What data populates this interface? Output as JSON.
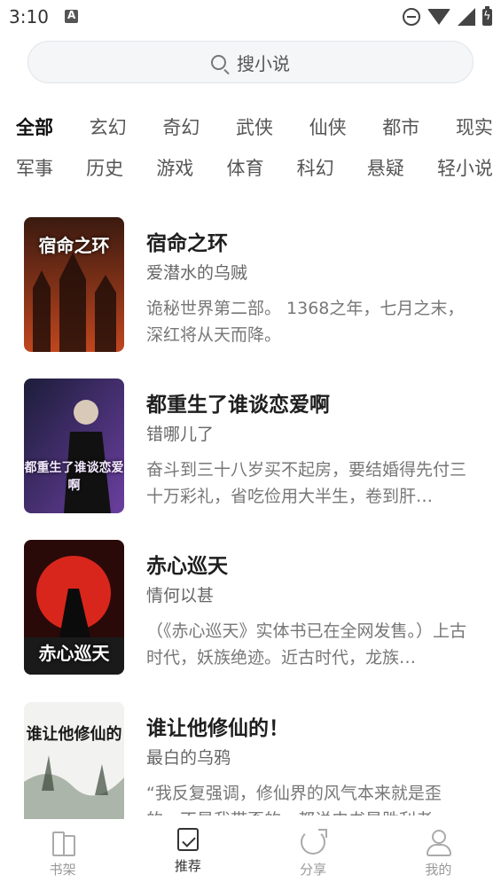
{
  "status_bar": {
    "time": "3:10"
  },
  "search": {
    "placeholder": "搜小说"
  },
  "categories": {
    "row1": [
      "全部",
      "玄幻",
      "奇幻",
      "武侠",
      "仙侠",
      "都市",
      "现实"
    ],
    "row2": [
      "军事",
      "历史",
      "游戏",
      "体育",
      "科幻",
      "悬疑",
      "轻小说"
    ],
    "active": "全部"
  },
  "books": [
    {
      "title": "宿命之环",
      "author": "爱潜水的乌贼",
      "desc": "诡秘世界第二部。 1368之年，七月之末，深红将从天而降。",
      "cover_text": "宿命之环",
      "cover_colors": [
        "#3a1a10",
        "#c0461f"
      ]
    },
    {
      "title": "都重生了谁谈恋爱啊",
      "author": "错哪儿了",
      "desc": "奋斗到三十八岁买不起房，要结婚得先付三十万彩礼，省吃俭用大半生，卷到肝…",
      "cover_text": "都重生了谁谈恋爱啊",
      "cover_colors": [
        "#1c1d3a",
        "#6b3fa0"
      ]
    },
    {
      "title": "赤心巡天",
      "author": "情何以甚",
      "desc": "（《赤心巡天》实体书已在全网发售。）上古时代，妖族绝迹。近古时代，龙族…",
      "cover_text": "赤心巡天",
      "cover_colors": [
        "#2a0a08",
        "#d9261c"
      ]
    },
    {
      "title": "谁让他修仙的！",
      "author": "最白的乌鸦",
      "desc": "“我反复强调，修仙界的风气本来就是歪的，不是我带歪的。都说史书是胜利者…",
      "cover_text": "谁让他修仙的",
      "cover_colors": [
        "#f2f2f0",
        "#7d8c7a"
      ]
    }
  ],
  "bottom_nav": [
    {
      "label": "书架",
      "icon": "bookshelf-icon"
    },
    {
      "label": "推荐",
      "icon": "bookmark-icon"
    },
    {
      "label": "分享",
      "icon": "share-icon"
    },
    {
      "label": "我的",
      "icon": "user-icon"
    }
  ]
}
